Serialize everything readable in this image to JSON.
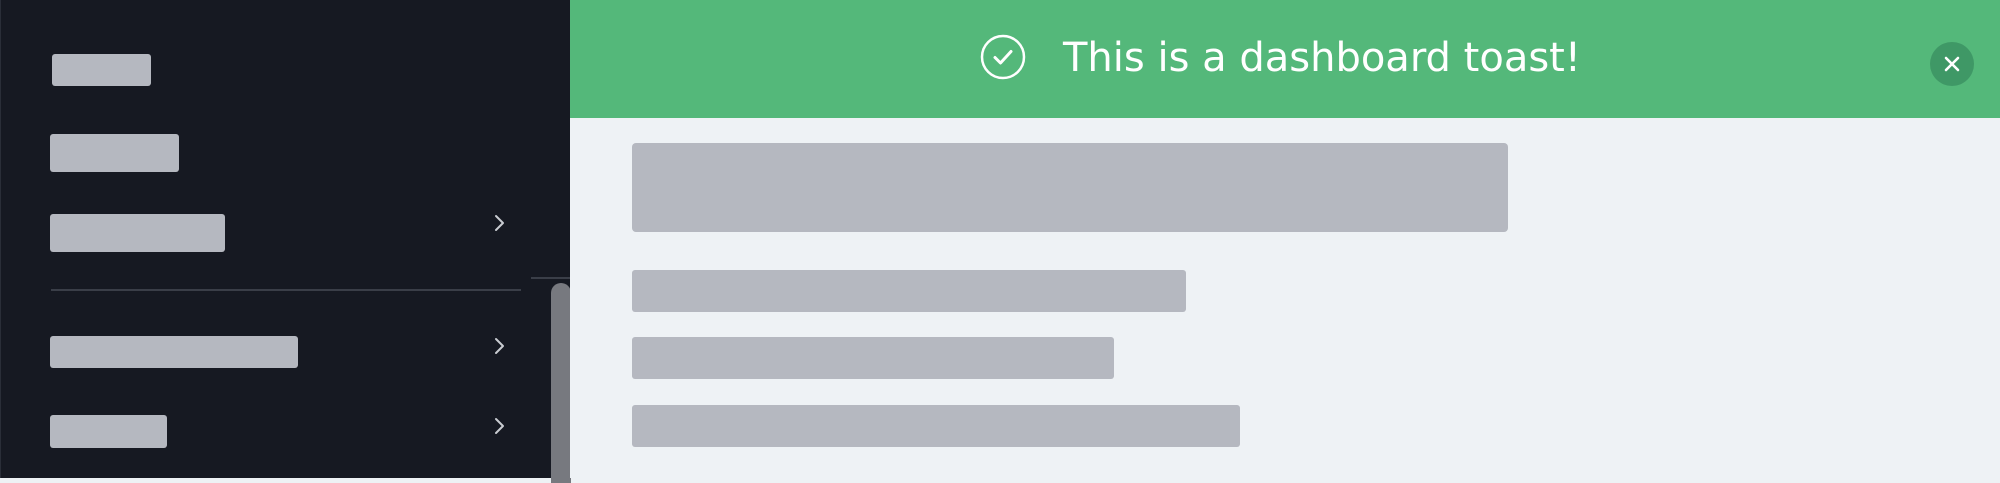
{
  "toast": {
    "message": "This is a dashboard toast!",
    "status_icon": "check-circle-icon",
    "close_icon": "close-icon",
    "color": "#54b87a"
  },
  "sidebar": {
    "background": "#161922",
    "items": [
      {
        "placeholder": true
      },
      {
        "placeholder": true
      },
      {
        "placeholder": true,
        "expand_icon": "chevron-right-icon"
      },
      {
        "placeholder": true,
        "expand_icon": "chevron-right-icon"
      },
      {
        "placeholder": true,
        "expand_icon": "chevron-right-icon"
      }
    ]
  },
  "content": {
    "loading": true
  }
}
